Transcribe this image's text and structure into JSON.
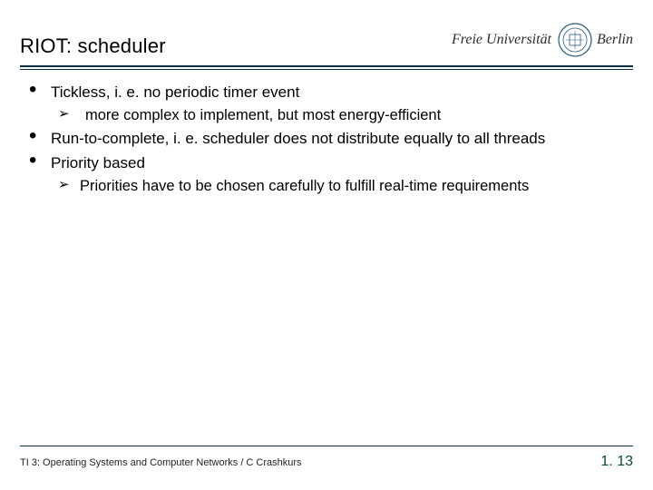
{
  "header": {
    "title": "RIOT: scheduler",
    "brand_text": "Freie Universität",
    "brand_city": "Berlin",
    "seal_name": "university-seal"
  },
  "content": {
    "bullets": [
      {
        "text": "Tickless, i. e. no periodic timer event",
        "subs": [
          "more complex to implement, but most energy-efficient"
        ]
      },
      {
        "text": "Run-to-complete, i. e. scheduler does not distribute equally to all threads",
        "subs": []
      },
      {
        "text": "Priority based",
        "subs": [
          "Priorities have to be chosen carefully to fulfill real-time requirements"
        ]
      }
    ]
  },
  "footer": {
    "left": "TI 3: Operating Systems and Computer Networks / C Crashkurs",
    "right": "1. 13"
  }
}
